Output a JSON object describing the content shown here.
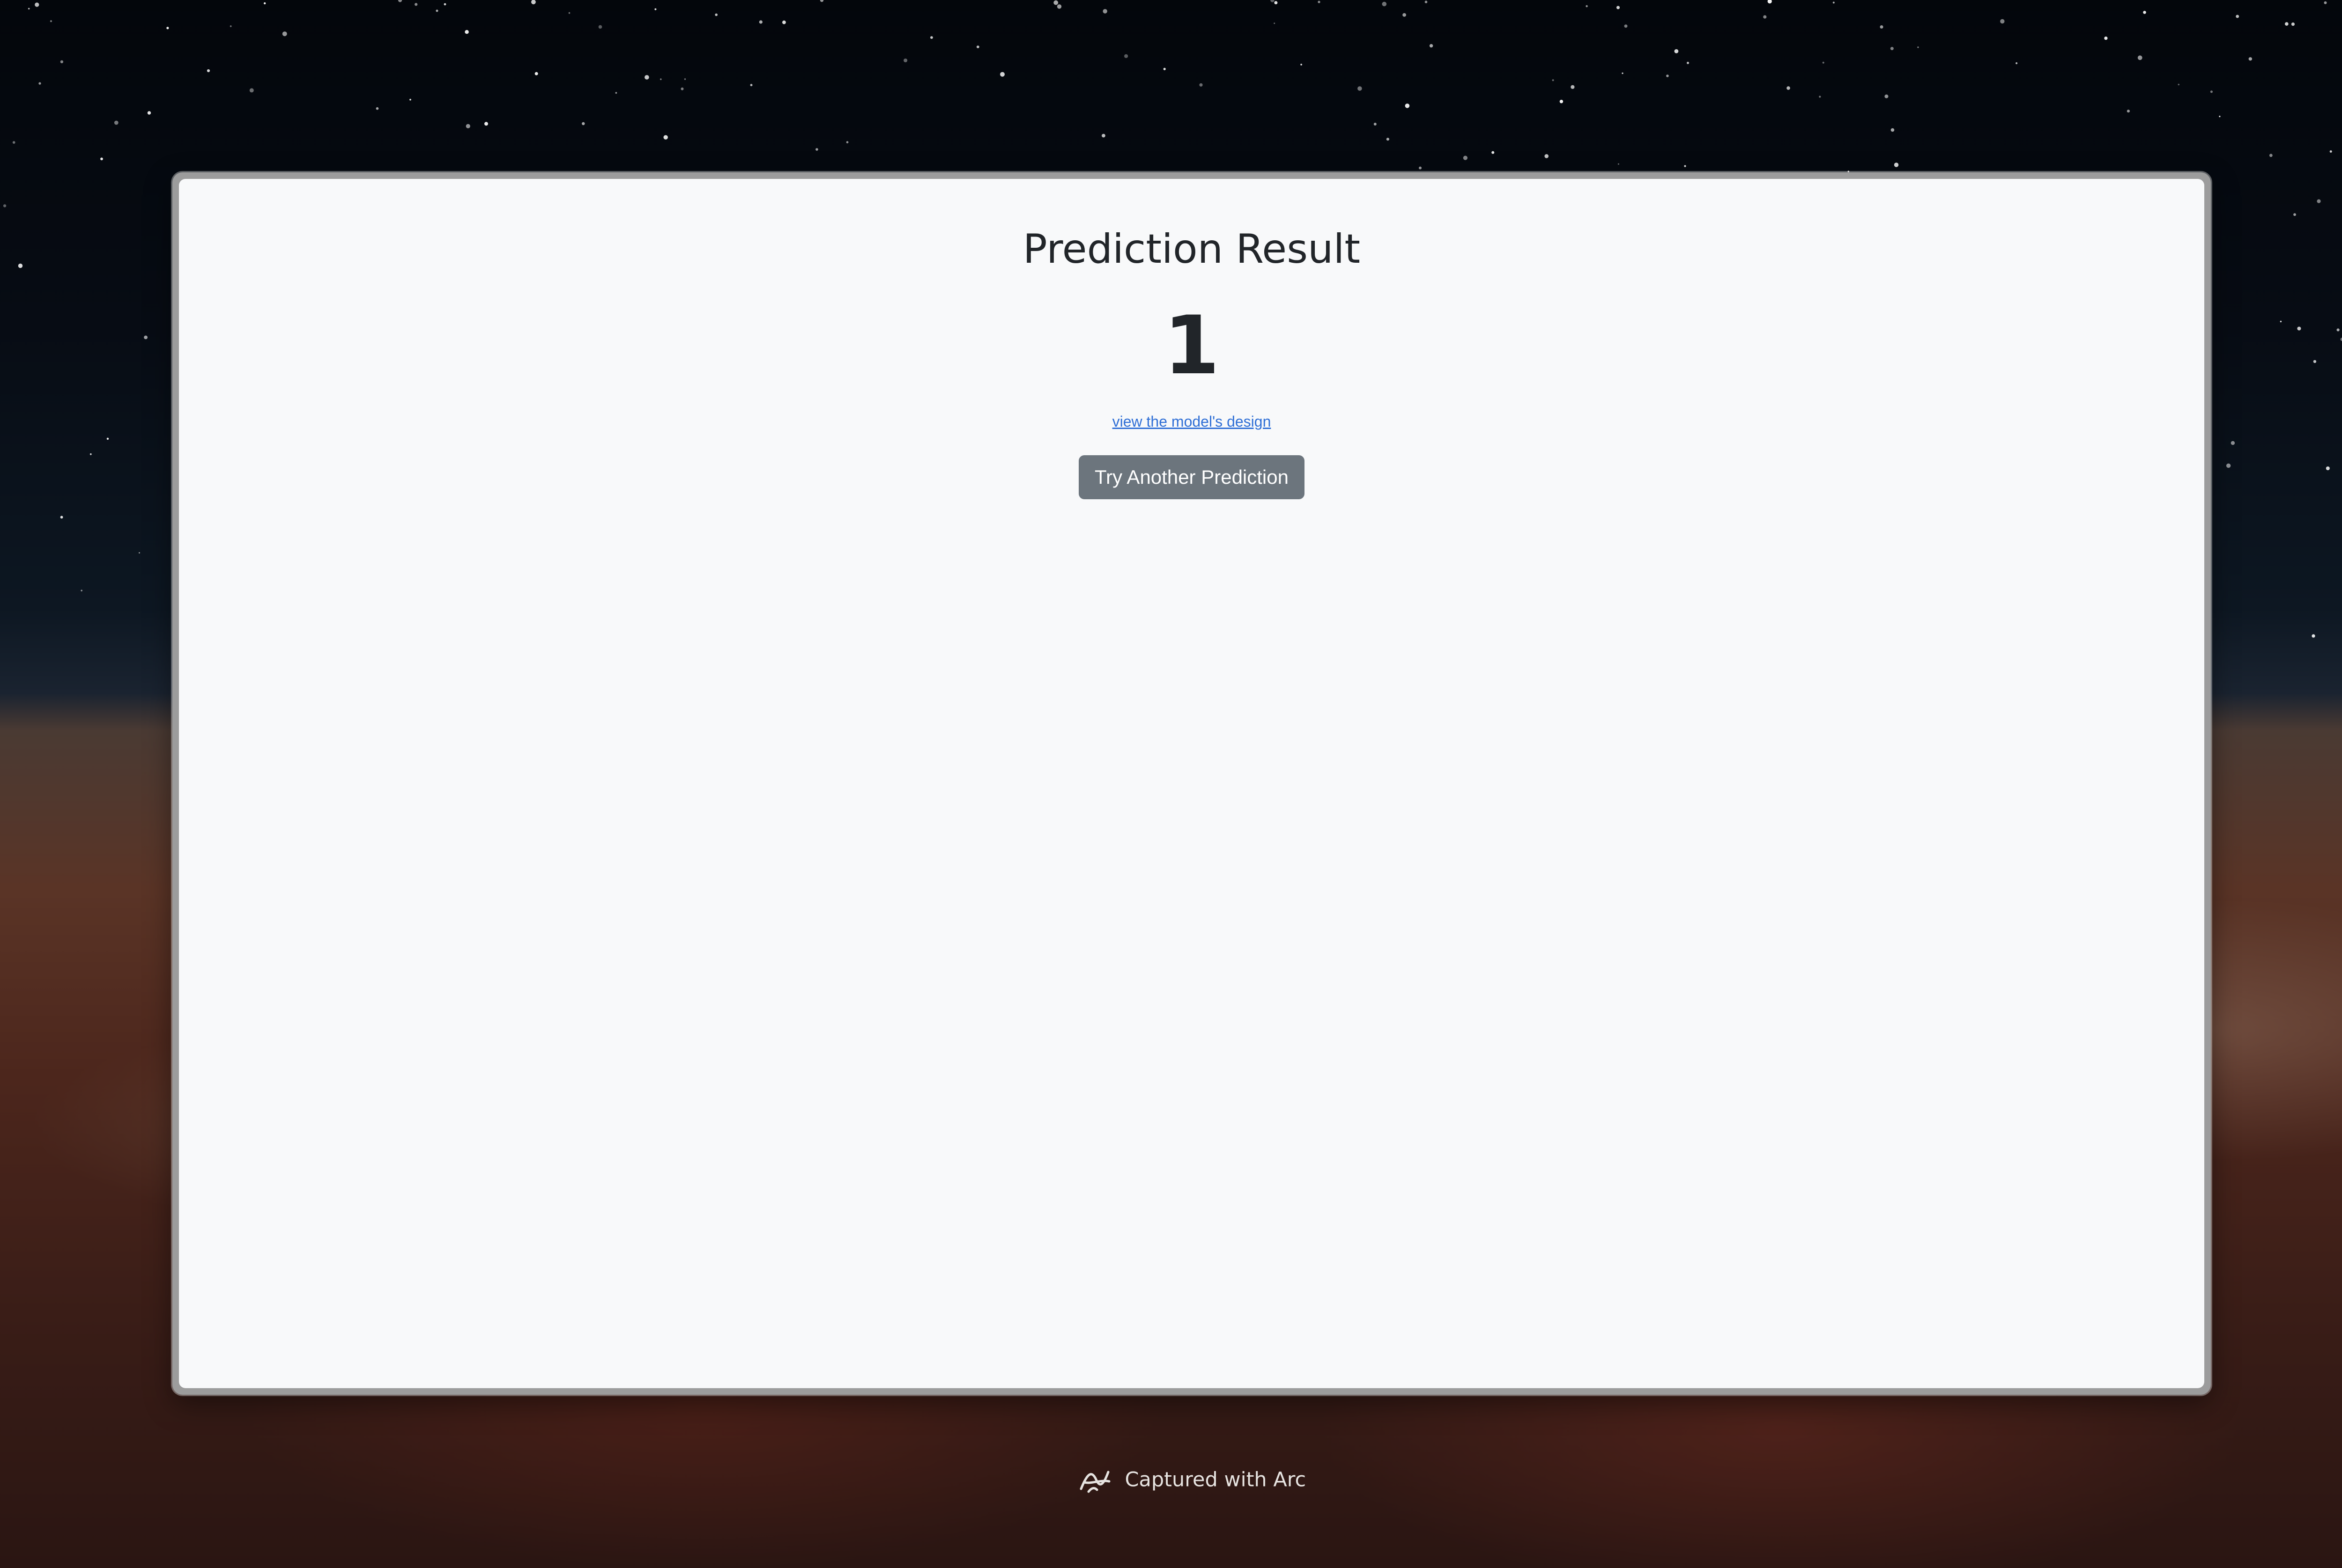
{
  "page": {
    "title": "Prediction Result",
    "result": "1",
    "design_link": "view the model's design",
    "try_button": "Try Another Prediction"
  },
  "footer": {
    "caption": "Captured with Arc",
    "icon": "arc-logo-icon"
  },
  "colors": {
    "link": "#2f6fd6",
    "button": "#6c757d",
    "page_background": "#f8f9fa"
  }
}
